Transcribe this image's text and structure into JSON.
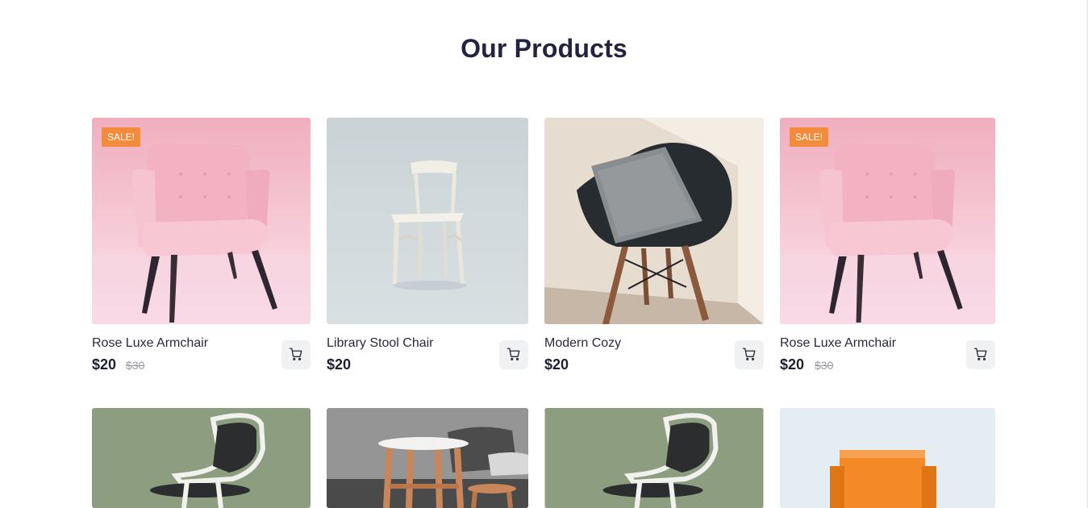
{
  "section": {
    "title": "Our Products"
  },
  "products": [
    {
      "name": "Rose Luxe Armchair",
      "price": "$20",
      "old_price": "$30",
      "badge": "SALE!"
    },
    {
      "name": "Library Stool Chair",
      "price": "$20"
    },
    {
      "name": "Modern Cozy",
      "price": "$20"
    },
    {
      "name": "Rose Luxe Armchair",
      "price": "$20",
      "old_price": "$30",
      "badge": "SALE!"
    }
  ],
  "icons": {
    "cart": "shopping-cart-icon"
  },
  "colors": {
    "badge": "#f28b3c",
    "heading": "#232340",
    "cart_bg": "#f0f1f3"
  }
}
